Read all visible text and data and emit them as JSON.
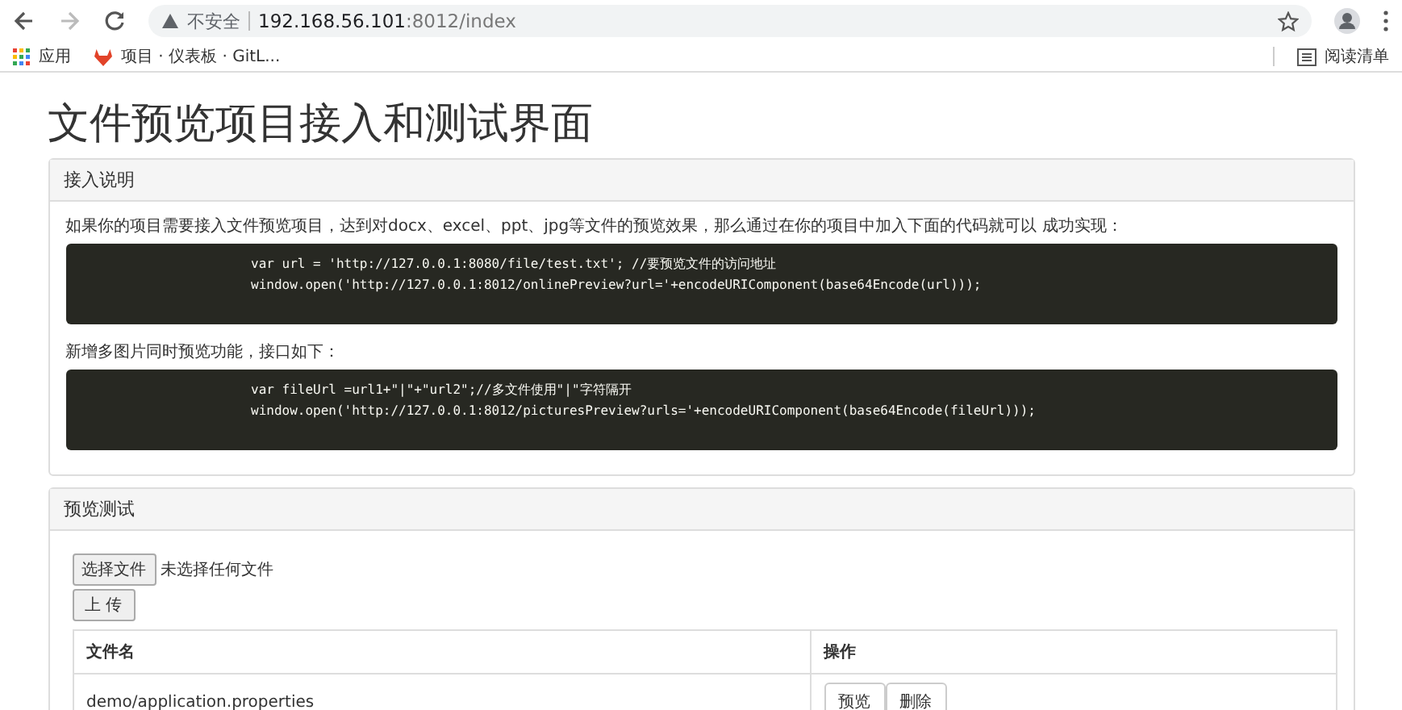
{
  "browser": {
    "security_label": "不安全",
    "url_host": "192.168.56.101",
    "url_rest": ":8012/index",
    "bookmarks": [
      {
        "kind": "apps",
        "label": "应用"
      },
      {
        "kind": "gitlab",
        "label": "项目 · 仪表板 · GitL..."
      }
    ],
    "reading_list": "阅读清单"
  },
  "page": {
    "title": "文件预览项目接入和测试界面",
    "panels": [
      {
        "kind": "docs",
        "heading": "接入说明",
        "blocks": [
          {
            "text": "如果你的项目需要接入文件预览项目，达到对docx、excel、ppt、jpg等文件的预览效果，那么通过在你的项目中加入下面的代码就可以 成功实现：",
            "code": [
              "var url = 'http://127.0.0.1:8080/file/test.txt'; //要预览文件的访问地址",
              "window.open('http://127.0.0.1:8012/onlinePreview?url='+encodeURIComponent(base64Encode(url)));"
            ]
          },
          {
            "text": "新增多图片同时预览功能，接口如下：",
            "code": [
              "var fileUrl =url1+\"|\"+\"url2\";//多文件使用\"|\"字符隔开",
              "window.open('http://127.0.0.1:8012/picturesPreview?urls='+encodeURIComponent(base64Encode(fileUrl)));"
            ]
          }
        ]
      },
      {
        "kind": "test",
        "heading": "预览测试",
        "choose_button": "选择文件",
        "no_file": "未选择任何文件",
        "upload_button": "上 传",
        "table": {
          "columns": [
            "文件名",
            "操作"
          ],
          "rows": [
            {
              "name": "demo/application.properties",
              "actions": [
                "预览",
                "删除"
              ]
            }
          ]
        }
      }
    ]
  }
}
